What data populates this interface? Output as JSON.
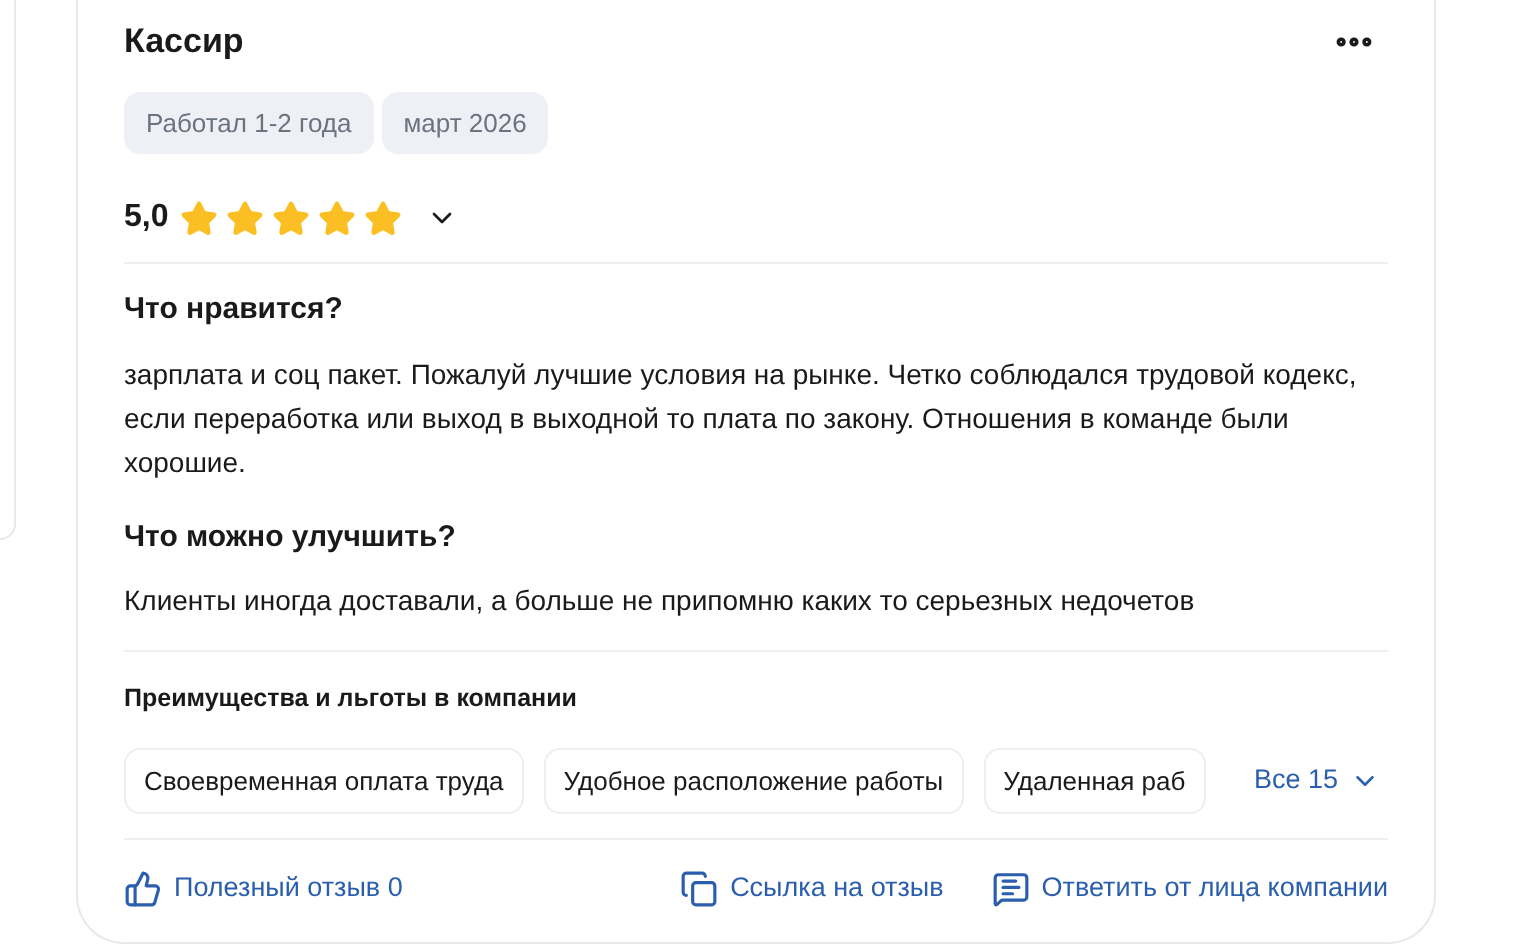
{
  "review": {
    "position": "Кассир",
    "tags": [
      "Работал 1-2 года",
      "март 2026"
    ],
    "rating": "5,0",
    "stars": 5,
    "sections": [
      {
        "title": "Что нравится?",
        "text": "зарплата и соц пакет. Пожалуй лучшие условия на рынке. Четко соблюдался трудовой кодекс, если переработка или выход в выходной то плата по закону. Отношения в команде были хорошие."
      },
      {
        "title": "Что можно улучшить?",
        "text": "Клиенты иногда доставали, а больше не припомню каких то серьезных недочетов"
      }
    ],
    "benefits_title": "Преимущества и льготы в компании",
    "benefits": [
      "Своевременная оплата труда",
      "Удобное расположение работы",
      "Удаленная раб"
    ],
    "benefits_more": "Все 15",
    "actions": [
      {
        "kind": "like",
        "label": "Полезный отзыв 0"
      },
      {
        "kind": "link",
        "label": "Ссылка на отзыв"
      },
      {
        "kind": "reply",
        "label": "Ответить от лица компании"
      }
    ]
  }
}
